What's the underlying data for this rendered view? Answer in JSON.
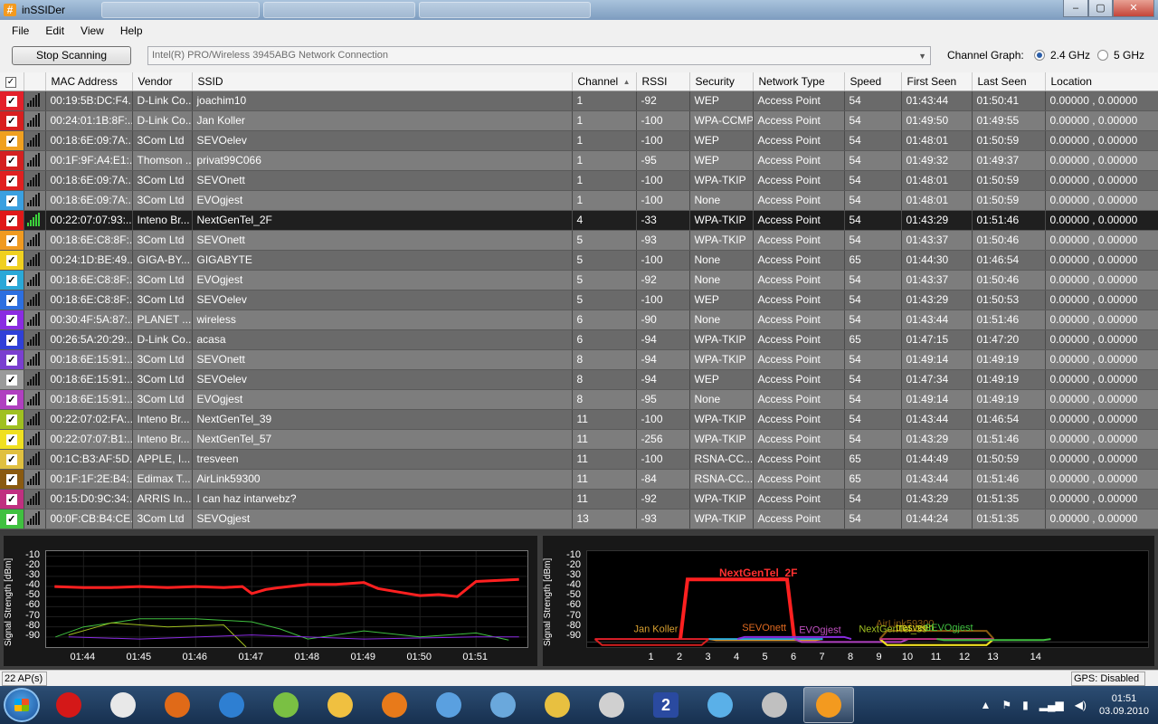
{
  "window": {
    "app_icon": "#",
    "title": "inSSIDer",
    "background_tabs": [
      "",
      "",
      ""
    ],
    "minimize": "–",
    "maximize": "▢",
    "close": "✕"
  },
  "menu": [
    "File",
    "Edit",
    "View",
    "Help"
  ],
  "toolbar": {
    "stop_label": "Stop Scanning",
    "adapter": "Intel(R) PRO/Wireless 3945ABG Network Connection",
    "channel_graph_label": "Channel Graph:",
    "band_24": "2.4 GHz",
    "band_5": "5 GHz",
    "selected_band": "2.4 GHz"
  },
  "table": {
    "columns": [
      "",
      "",
      "MAC Address",
      "Vendor",
      "SSID",
      "Channel",
      "RSSI",
      "Security",
      "Network Type",
      "Speed",
      "First Seen",
      "Last Seen",
      "Location"
    ],
    "sorted_column": "Channel",
    "selected_ssid": "NextGenTel_2F",
    "rows": [
      {
        "color": "#e3202a",
        "mac": "00:19:5B:DC:F4...",
        "vendor": "D-Link Co...",
        "ssid": "joachim10",
        "channel": "1",
        "rssi": "-92",
        "security": "WEP",
        "type": "Access Point",
        "speed": "54",
        "first": "01:43:44",
        "last": "01:50:41",
        "location": "0.00000 , 0.00000"
      },
      {
        "color": "#d81f1f",
        "mac": "00:24:01:1B:8F:...",
        "vendor": "D-Link Co...",
        "ssid": "Jan Koller",
        "channel": "1",
        "rssi": "-100",
        "security": "WPA-CCMP",
        "type": "Access Point",
        "speed": "54",
        "first": "01:49:50",
        "last": "01:49:55",
        "location": "0.00000 , 0.00000"
      },
      {
        "color": "#f0a020",
        "mac": "00:18:6E:09:7A:...",
        "vendor": "3Com Ltd",
        "ssid": "SEVOelev",
        "channel": "1",
        "rssi": "-100",
        "security": "WEP",
        "type": "Access Point",
        "speed": "54",
        "first": "01:48:01",
        "last": "01:50:59",
        "location": "0.00000 , 0.00000"
      },
      {
        "color": "#d42020",
        "mac": "00:1F:9F:A4:E1:...",
        "vendor": "Thomson ...",
        "ssid": "privat99C066",
        "channel": "1",
        "rssi": "-95",
        "security": "WEP",
        "type": "Access Point",
        "speed": "54",
        "first": "01:49:32",
        "last": "01:49:37",
        "location": "0.00000 , 0.00000"
      },
      {
        "color": "#e02020",
        "mac": "00:18:6E:09:7A:...",
        "vendor": "3Com Ltd",
        "ssid": "SEVOnett",
        "channel": "1",
        "rssi": "-100",
        "security": "WPA-TKIP",
        "type": "Access Point",
        "speed": "54",
        "first": "01:48:01",
        "last": "01:50:59",
        "location": "0.00000 , 0.00000"
      },
      {
        "color": "#3aa0e0",
        "mac": "00:18:6E:09:7A:...",
        "vendor": "3Com Ltd",
        "ssid": "EVOgjest",
        "channel": "1",
        "rssi": "-100",
        "security": "None",
        "type": "Access Point",
        "speed": "54",
        "first": "01:48:01",
        "last": "01:50:59",
        "location": "0.00000 , 0.00000"
      },
      {
        "color": "#e01818",
        "mac": "00:22:07:07:93:...",
        "vendor": "Inteno Br...",
        "ssid": "NextGenTel_2F",
        "channel": "4",
        "rssi": "-33",
        "security": "WPA-TKIP",
        "type": "Access Point",
        "speed": "54",
        "first": "01:43:29",
        "last": "01:51:46",
        "location": "0.00000 , 0.00000"
      },
      {
        "color": "#f09a20",
        "mac": "00:18:6E:C8:8F:...",
        "vendor": "3Com Ltd",
        "ssid": "SEVOnett",
        "channel": "5",
        "rssi": "-93",
        "security": "WPA-TKIP",
        "type": "Access Point",
        "speed": "54",
        "first": "01:43:37",
        "last": "01:50:46",
        "location": "0.00000 , 0.00000"
      },
      {
        "color": "#f0d020",
        "mac": "00:24:1D:BE:49...",
        "vendor": "GIGA-BY...",
        "ssid": "GIGABYTE",
        "channel": "5",
        "rssi": "-100",
        "security": "None",
        "type": "Access Point",
        "speed": "65",
        "first": "01:44:30",
        "last": "01:46:54",
        "location": "0.00000 , 0.00000"
      },
      {
        "color": "#2aa8d8",
        "mac": "00:18:6E:C8:8F:...",
        "vendor": "3Com Ltd",
        "ssid": "EVOgjest",
        "channel": "5",
        "rssi": "-92",
        "security": "None",
        "type": "Access Point",
        "speed": "54",
        "first": "01:43:37",
        "last": "01:50:46",
        "location": "0.00000 , 0.00000"
      },
      {
        "color": "#2d6fe0",
        "mac": "00:18:6E:C8:8F:...",
        "vendor": "3Com Ltd",
        "ssid": "SEVOelev",
        "channel": "5",
        "rssi": "-100",
        "security": "WEP",
        "type": "Access Point",
        "speed": "54",
        "first": "01:43:29",
        "last": "01:50:53",
        "location": "0.00000 , 0.00000"
      },
      {
        "color": "#8a2be2",
        "mac": "00:30:4F:5A:87:...",
        "vendor": "PLANET ...",
        "ssid": "wireless",
        "channel": "6",
        "rssi": "-90",
        "security": "None",
        "type": "Access Point",
        "speed": "54",
        "first": "01:43:44",
        "last": "01:51:46",
        "location": "0.00000 , 0.00000"
      },
      {
        "color": "#3040d8",
        "mac": "00:26:5A:20:29:...",
        "vendor": "D-Link Co...",
        "ssid": "acasa",
        "channel": "6",
        "rssi": "-94",
        "security": "WPA-TKIP",
        "type": "Access Point",
        "speed": "65",
        "first": "01:47:15",
        "last": "01:47:20",
        "location": "0.00000 , 0.00000"
      },
      {
        "color": "#7a3fd0",
        "mac": "00:18:6E:15:91:...",
        "vendor": "3Com Ltd",
        "ssid": "SEVOnett",
        "channel": "8",
        "rssi": "-94",
        "security": "WPA-TKIP",
        "type": "Access Point",
        "speed": "54",
        "first": "01:49:14",
        "last": "01:49:19",
        "location": "0.00000 , 0.00000"
      },
      {
        "color": "#9a9a9a",
        "mac": "00:18:6E:15:91:...",
        "vendor": "3Com Ltd",
        "ssid": "SEVOelev",
        "channel": "8",
        "rssi": "-94",
        "security": "WEP",
        "type": "Access Point",
        "speed": "54",
        "first": "01:47:34",
        "last": "01:49:19",
        "location": "0.00000 , 0.00000"
      },
      {
        "color": "#b040c0",
        "mac": "00:18:6E:15:91:...",
        "vendor": "3Com Ltd",
        "ssid": "EVOgjest",
        "channel": "8",
        "rssi": "-95",
        "security": "None",
        "type": "Access Point",
        "speed": "54",
        "first": "01:49:14",
        "last": "01:49:19",
        "location": "0.00000 , 0.00000"
      },
      {
        "color": "#a0c020",
        "mac": "00:22:07:02:FA:...",
        "vendor": "Inteno Br...",
        "ssid": "NextGenTel_39",
        "channel": "11",
        "rssi": "-100",
        "security": "WPA-TKIP",
        "type": "Access Point",
        "speed": "54",
        "first": "01:43:44",
        "last": "01:46:54",
        "location": "0.00000 , 0.00000"
      },
      {
        "color": "#f0e020",
        "mac": "00:22:07:07:B1:...",
        "vendor": "Inteno Br...",
        "ssid": "NextGenTel_57",
        "channel": "11",
        "rssi": "-256",
        "security": "WPA-TKIP",
        "type": "Access Point",
        "speed": "54",
        "first": "01:43:29",
        "last": "01:51:46",
        "location": "0.00000 , 0.00000"
      },
      {
        "color": "#e0c040",
        "mac": "00:1C:B3:AF:5D...",
        "vendor": "APPLE, I...",
        "ssid": "tresveen",
        "channel": "11",
        "rssi": "-100",
        "security": "RSNA-CC...",
        "type": "Access Point",
        "speed": "65",
        "first": "01:44:49",
        "last": "01:50:59",
        "location": "0.00000 , 0.00000"
      },
      {
        "color": "#8a5a10",
        "mac": "00:1F:1F:2E:B4:...",
        "vendor": "Edimax T...",
        "ssid": "AirLink59300",
        "channel": "11",
        "rssi": "-84",
        "security": "RSNA-CC...",
        "type": "Access Point",
        "speed": "65",
        "first": "01:43:44",
        "last": "01:51:46",
        "location": "0.00000 , 0.00000"
      },
      {
        "color": "#c03080",
        "mac": "00:15:D0:9C:34:...",
        "vendor": "ARRIS In...",
        "ssid": "I can haz intarwebz?",
        "channel": "11",
        "rssi": "-92",
        "security": "WPA-TKIP",
        "type": "Access Point",
        "speed": "54",
        "first": "01:43:29",
        "last": "01:51:35",
        "location": "0.00000 , 0.00000"
      },
      {
        "color": "#40c040",
        "mac": "00:0F:CB:B4:CE...",
        "vendor": "3Com Ltd",
        "ssid": "SEVOgjest",
        "channel": "13",
        "rssi": "-93",
        "security": "WPA-TKIP",
        "type": "Access Point",
        "speed": "54",
        "first": "01:44:24",
        "last": "01:51:35",
        "location": "0.00000 , 0.00000"
      }
    ]
  },
  "chart_data": [
    {
      "type": "line",
      "ylabel": "Signal Strength [dBm]",
      "ylim": [
        -100,
        -5
      ],
      "y_ticks": [
        -10,
        -20,
        -30,
        -40,
        -50,
        -60,
        -70,
        -80,
        -90
      ],
      "x_ticks": [
        "01:44",
        "01:45",
        "01:46",
        "01:47",
        "01:48",
        "01:49",
        "01:50",
        "01:51"
      ],
      "series": [
        {
          "color": "#ff2020",
          "x": [
            "01:43:29",
            "01:44:00",
            "01:44:30",
            "01:45:00",
            "01:45:30",
            "01:46:00",
            "01:46:30",
            "01:46:50",
            "01:47:00",
            "01:47:15",
            "01:47:30",
            "01:48:00",
            "01:48:30",
            "01:49:00",
            "01:49:15",
            "01:49:40",
            "01:50:00",
            "01:50:20",
            "01:50:40",
            "01:51:00",
            "01:51:46"
          ],
          "values": [
            -40,
            -41,
            -41,
            -40,
            -41,
            -40,
            -41,
            -40,
            -47,
            -43,
            -41,
            -38,
            -38,
            -36,
            -42,
            -46,
            -49,
            -48,
            -50,
            -35,
            -33
          ]
        },
        {
          "color": "#40c040",
          "x": [
            "01:43:30",
            "01:44:00",
            "01:45:00",
            "01:46:00",
            "01:47:00",
            "01:47:30",
            "01:48:00",
            "01:49:00",
            "01:50:00",
            "01:51:00",
            "01:51:35"
          ],
          "values": [
            -90,
            -80,
            -72,
            -72,
            -75,
            -82,
            -92,
            -84,
            -90,
            -86,
            -93
          ]
        },
        {
          "color": "#a0c020",
          "x": [
            "01:43:44",
            "01:44:30",
            "01:45:30",
            "01:46:30",
            "01:46:54"
          ],
          "values": [
            -88,
            -76,
            -80,
            -78,
            -100
          ]
        },
        {
          "color": "#8a2be2",
          "x": [
            "01:43:44",
            "01:45:00",
            "01:47:00",
            "01:49:00",
            "01:51:00",
            "01:51:46"
          ],
          "values": [
            -90,
            -92,
            -88,
            -92,
            -90,
            -90
          ]
        }
      ]
    },
    {
      "type": "area",
      "ylabel": "Signal Strength [dBm]",
      "ylim": [
        -100,
        -5
      ],
      "y_ticks": [
        -10,
        -20,
        -30,
        -40,
        -50,
        -60,
        -70,
        -80,
        -90
      ],
      "x_ticks": [
        "1",
        "2",
        "3",
        "4",
        "5",
        "6",
        "7",
        "8",
        "9",
        "10",
        "11",
        "12",
        "13",
        "14"
      ],
      "series": [
        {
          "name": "NextGenTel_2F",
          "color": "#ff2020",
          "channel": 4,
          "rssi": -33
        },
        {
          "name": "Jan Koller",
          "color": "#d81f1f",
          "channel": 1,
          "rssi": -100
        },
        {
          "name": "joachim10",
          "color": "#e3202a",
          "channel": 1,
          "rssi": -92
        },
        {
          "name": "SEVOnett",
          "color": "#f09a20",
          "channel": 5,
          "rssi": -93
        },
        {
          "name": "EVOgjest",
          "color": "#2aa8d8",
          "channel": 5,
          "rssi": -92
        },
        {
          "name": "wireless",
          "color": "#8a2be2",
          "channel": 6,
          "rssi": -90
        },
        {
          "name": "EVOgjest",
          "color": "#b040c0",
          "channel": 8,
          "rssi": -95
        },
        {
          "name": "AirLink59300",
          "color": "#8a5a10",
          "channel": 11,
          "rssi": -84
        },
        {
          "name": "tresveen",
          "color": "#e0c040",
          "channel": 11,
          "rssi": -100
        },
        {
          "name": "NextGenTel_57",
          "color": "#f0e020",
          "channel": 11,
          "rssi": -100
        },
        {
          "name": "I can haz intarwebz?",
          "color": "#c03080",
          "channel": 11,
          "rssi": -92
        },
        {
          "name": "SEVOgjest",
          "color": "#40c040",
          "channel": 13,
          "rssi": -93
        }
      ],
      "overlay_labels": [
        "NextGenTel_2F",
        "Jan Koller",
        "SEVOnett",
        "EVOgjest",
        "AirLink59300",
        "NextGenTel_39",
        "tresveen",
        "SEVOgjest"
      ]
    }
  ],
  "status": {
    "ap_count": "22 AP(s)",
    "gps": "GPS: Disabled"
  },
  "taskbar": {
    "apps": [
      "opera-icon",
      "chrome-icon",
      "firefox-icon",
      "ie-icon",
      "spotify-icon",
      "explorer-folder-icon",
      "media-player-icon",
      "messenger-icon",
      "notepad-icon",
      "lock-icon",
      "calculator-icon",
      "app-2-icon",
      "itunes-icon",
      "tool-icon",
      "inssider-icon"
    ],
    "app_colors": [
      "#d41818",
      "#e8e8e8",
      "#e06a18",
      "#2e7fd2",
      "#7ac043",
      "#f0c040",
      "#e87a1a",
      "#5aa0e0",
      "#6aa8dc",
      "#e8c040",
      "#d0d0d0",
      "#2a4aa0",
      "#5ab0e8",
      "#c0c0c0",
      "#f39a1f"
    ],
    "active_app": "inssider-icon",
    "app_2_label": "2",
    "clock_time": "01:51",
    "clock_date": "03.09.2010"
  }
}
